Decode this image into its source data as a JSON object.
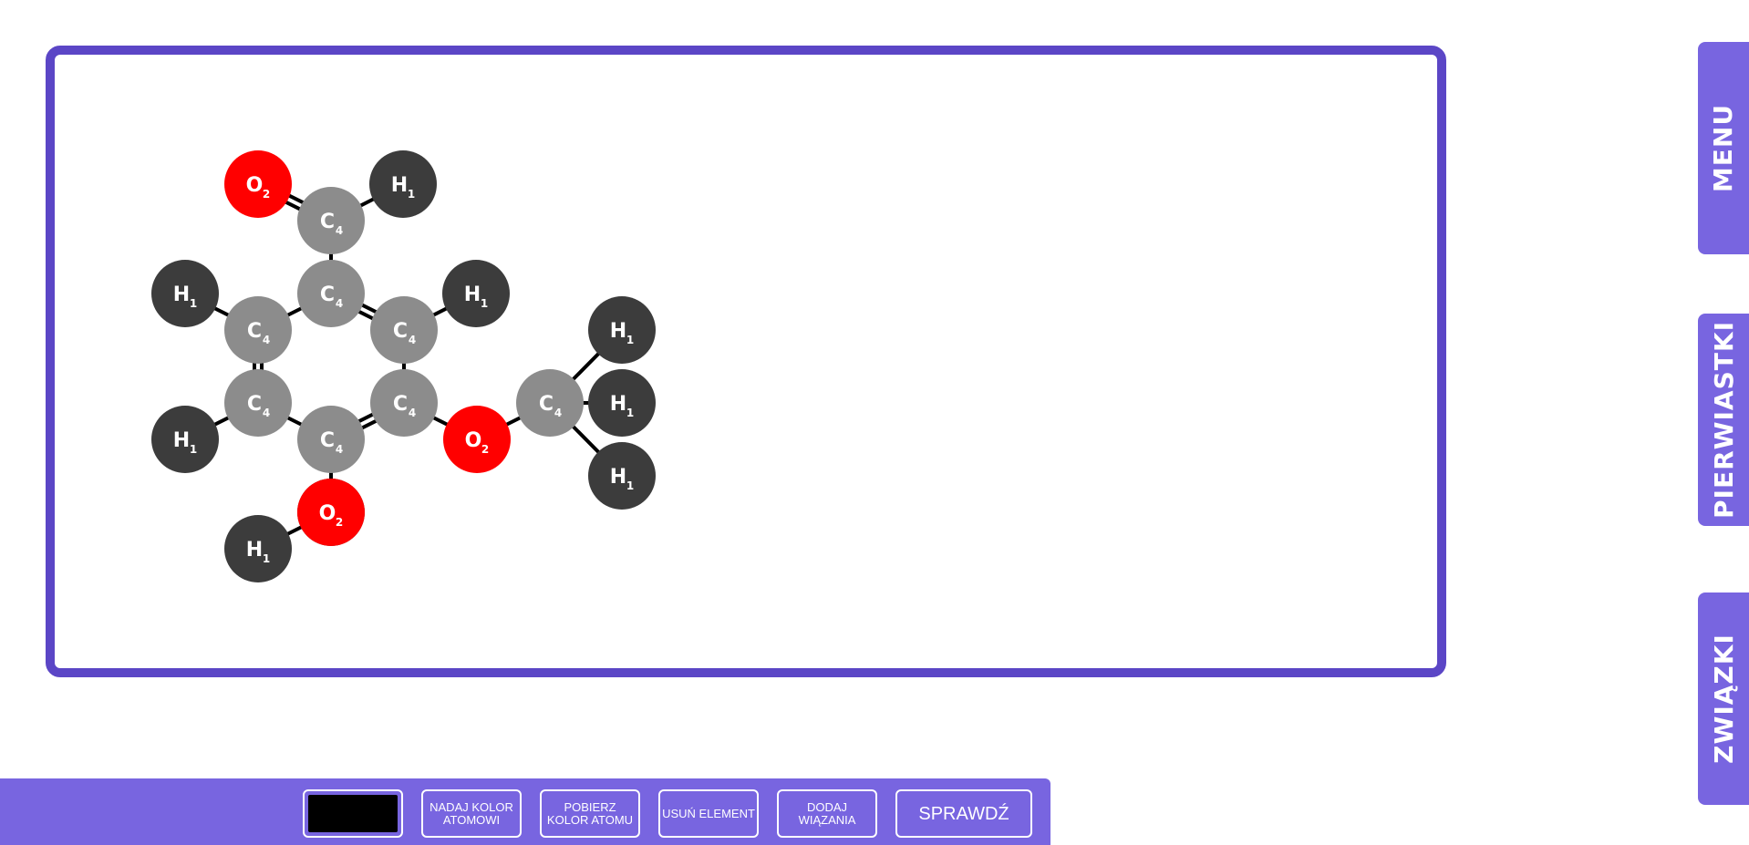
{
  "side_tabs": {
    "menu": "MENU",
    "elements": "PIERWIASTKI",
    "compounds": "ZWIĄZKI"
  },
  "toolbar": {
    "selected_color": "#000000",
    "assign_color": "NADAJ KOLOR ATOMOWI",
    "get_color": "POBIERZ KOLOR ATOMU",
    "delete_element": "USUŃ ELEMENT",
    "add_bonds": "DODAJ WIĄZANIA",
    "check": "SPRAWDŹ"
  },
  "colors": {
    "accent": "#5b46c6",
    "panel": "#7865e0",
    "oxygen": "#ff0000",
    "carbon": "#8c8c8c",
    "hydrogen": "#3c3c3c",
    "bond": "#000000"
  },
  "molecule": {
    "atoms": [
      {
        "id": "o1",
        "symbol": "O",
        "valence": "2"
      },
      {
        "id": "c1",
        "symbol": "C",
        "valence": "4"
      },
      {
        "id": "h1",
        "symbol": "H",
        "valence": "1"
      },
      {
        "id": "c2",
        "symbol": "C",
        "valence": "4"
      },
      {
        "id": "h2",
        "symbol": "H",
        "valence": "1"
      },
      {
        "id": "c3",
        "symbol": "C",
        "valence": "4"
      },
      {
        "id": "c4",
        "symbol": "C",
        "valence": "4"
      },
      {
        "id": "h3",
        "symbol": "H",
        "valence": "1"
      },
      {
        "id": "h4",
        "symbol": "H",
        "valence": "1"
      },
      {
        "id": "c5",
        "symbol": "C",
        "valence": "4"
      },
      {
        "id": "c6",
        "symbol": "C",
        "valence": "4"
      },
      {
        "id": "c7",
        "symbol": "C",
        "valence": "4"
      },
      {
        "id": "h5",
        "symbol": "H",
        "valence": "1"
      },
      {
        "id": "o2",
        "symbol": "O",
        "valence": "2"
      },
      {
        "id": "c8",
        "symbol": "C",
        "valence": "4"
      },
      {
        "id": "h6",
        "symbol": "H",
        "valence": "1"
      },
      {
        "id": "h7",
        "symbol": "H",
        "valence": "1"
      },
      {
        "id": "h8",
        "symbol": "H",
        "valence": "1"
      },
      {
        "id": "o3",
        "symbol": "O",
        "valence": "2"
      },
      {
        "id": "h9",
        "symbol": "H",
        "valence": "1"
      }
    ],
    "bonds": [
      {
        "a": "o1",
        "b": "c1",
        "order": 2
      },
      {
        "a": "c1",
        "b": "h1",
        "order": 1
      },
      {
        "a": "c1",
        "b": "c2",
        "order": 1
      },
      {
        "a": "c2",
        "b": "c3",
        "order": 1
      },
      {
        "a": "c2",
        "b": "c4",
        "order": 2
      },
      {
        "a": "h2",
        "b": "c3",
        "order": 1
      },
      {
        "a": "c4",
        "b": "h3",
        "order": 1
      },
      {
        "a": "c3",
        "b": "c5",
        "order": 2
      },
      {
        "a": "c4",
        "b": "c7",
        "order": 1
      },
      {
        "a": "h4",
        "b": "c5",
        "order": 1
      },
      {
        "a": "c5",
        "b": "c6",
        "order": 1
      },
      {
        "a": "c6",
        "b": "c7",
        "order": 2
      },
      {
        "a": "c7",
        "b": "o2",
        "order": 1
      },
      {
        "a": "o2",
        "b": "c8",
        "order": 1
      },
      {
        "a": "c8",
        "b": "h5",
        "order": 1
      },
      {
        "a": "c8",
        "b": "h6",
        "order": 1
      },
      {
        "a": "c8",
        "b": "h7",
        "order": 1
      },
      {
        "a": "c6",
        "b": "o3",
        "order": 1
      },
      {
        "a": "o3",
        "b": "h8",
        "order": 1
      }
    ]
  }
}
